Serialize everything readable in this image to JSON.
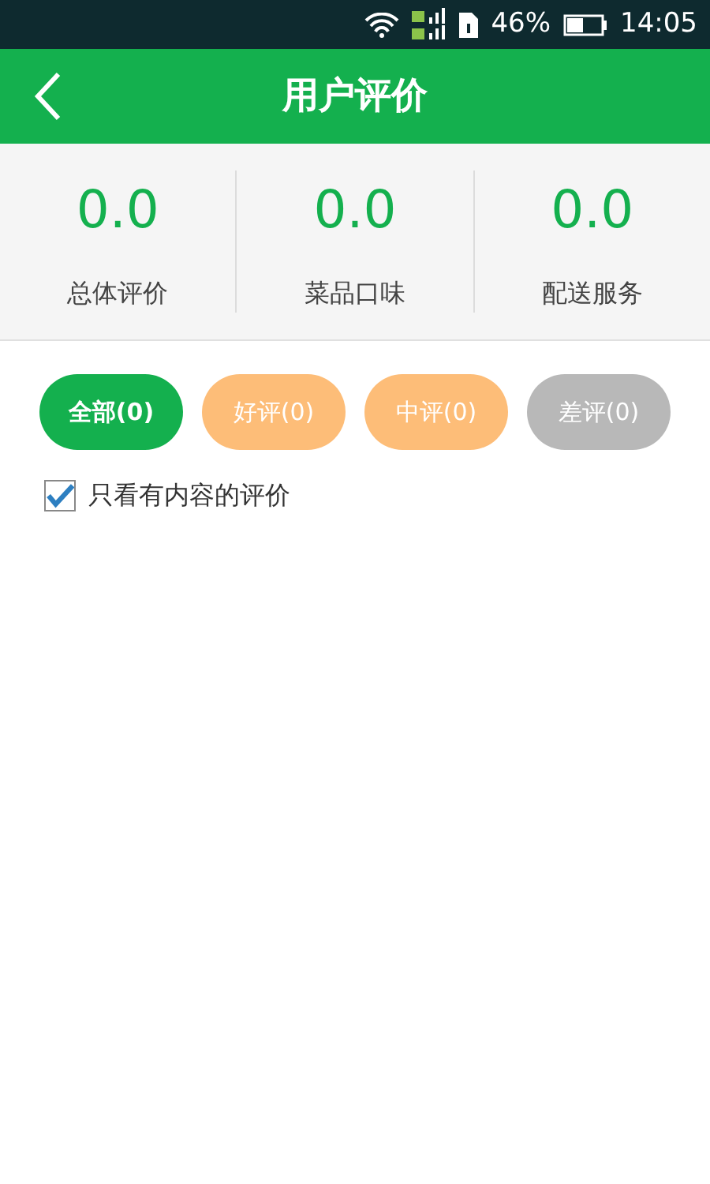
{
  "status_bar": {
    "battery": "46%",
    "time": "14:05"
  },
  "header": {
    "title": "用户评价"
  },
  "scores": [
    {
      "value": "0.0",
      "label": "总体评价"
    },
    {
      "value": "0.0",
      "label": "菜品口味"
    },
    {
      "value": "0.0",
      "label": "配送服务"
    }
  ],
  "filters": [
    {
      "label": "全部(0)",
      "selected": true,
      "color": "#14b04e"
    },
    {
      "label": "好评(0)",
      "selected": false,
      "color": "#fdbd78"
    },
    {
      "label": "中评(0)",
      "selected": false,
      "color": "#fdbd78"
    },
    {
      "label": "差评(0)",
      "selected": false,
      "color": "#b8b8b8"
    }
  ],
  "content_only": {
    "label": "只看有内容的评价",
    "checked": true
  }
}
